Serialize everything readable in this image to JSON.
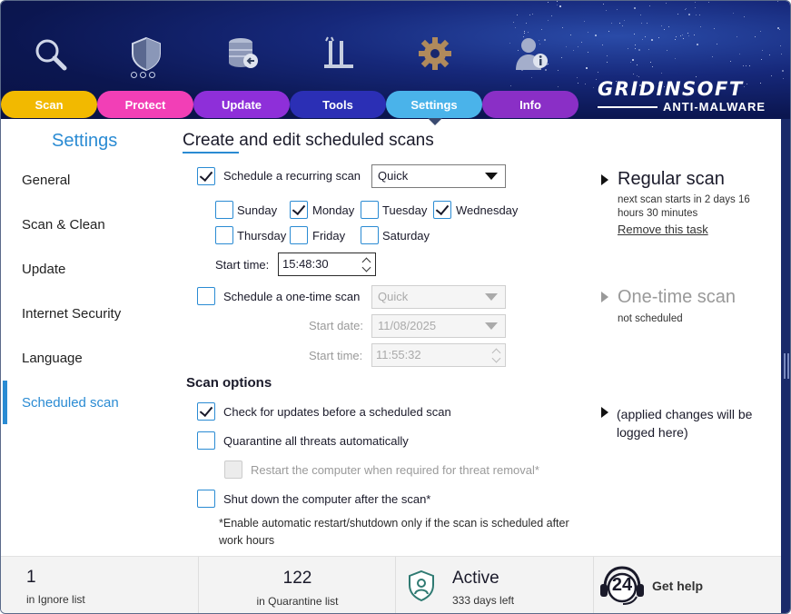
{
  "header": {
    "logo_main": "GRIDINSOFT",
    "logo_sub": "ANTI-MALWARE",
    "top_icons": [
      "search-icon",
      "shield-icon",
      "database-icon",
      "tools-icon",
      "gear-icon",
      "user-info-icon"
    ],
    "tabs": [
      {
        "label": "Scan",
        "color": "#f2b900"
      },
      {
        "label": "Protect",
        "color": "#f23fb6"
      },
      {
        "label": "Update",
        "color": "#8e2fd9"
      },
      {
        "label": "Tools",
        "color": "#2b2fb5"
      },
      {
        "label": "Settings",
        "color": "#4ab3ea"
      },
      {
        "label": "Info",
        "color": "#8a2fc6"
      }
    ]
  },
  "sidebar": {
    "title": "Settings",
    "items": [
      "General",
      "Scan & Clean",
      "Update",
      "Internet Security",
      "Language",
      "Scheduled scan"
    ],
    "active": "Scheduled scan"
  },
  "main": {
    "title": "Create and edit scheduled scans",
    "recurring": {
      "label": "Schedule a recurring scan",
      "checked": true,
      "type_value": "Quick",
      "days": [
        {
          "label": "Sunday",
          "checked": false
        },
        {
          "label": "Monday",
          "checked": true
        },
        {
          "label": "Tuesday",
          "checked": false
        },
        {
          "label": "Wednesday",
          "checked": true
        },
        {
          "label": "Thursday",
          "checked": false
        },
        {
          "label": "Friday",
          "checked": false
        },
        {
          "label": "Saturday",
          "checked": false
        }
      ],
      "start_time_label": "Start time:",
      "start_time_value": "15:48:30"
    },
    "one_time": {
      "label": "Schedule a one-time scan",
      "checked": false,
      "type_value": "Quick",
      "start_date_label": "Start date:",
      "start_date_value": "11/08/2025",
      "start_time_label": "Start time:",
      "start_time_value": "11:55:32"
    },
    "scan_options": {
      "heading": "Scan options",
      "check_updates": "Check for updates before a scheduled scan",
      "quarantine": "Quarantine all threats automatically",
      "restart": "Restart the computer when required for threat removal*",
      "shutdown": "Shut down the computer after the scan*",
      "note": "*Enable automatic restart/shutdown only if the scan is scheduled after work hours"
    }
  },
  "right": {
    "regular_title": "Regular scan",
    "regular_sub": "next scan starts in 2 days 16 hours 30 minutes",
    "remove_link": "Remove this task",
    "onetime_title": "One-time scan",
    "onetime_sub": "not scheduled",
    "log_note": "(applied changes will be logged here)"
  },
  "footer": {
    "ignore_count": "1",
    "ignore_label": "in Ignore list",
    "quarantine_count": "122",
    "quarantine_label": "in Quarantine list",
    "status": "Active",
    "days_left": "333 days left",
    "help_badge": "24",
    "help_label": "Get help"
  }
}
